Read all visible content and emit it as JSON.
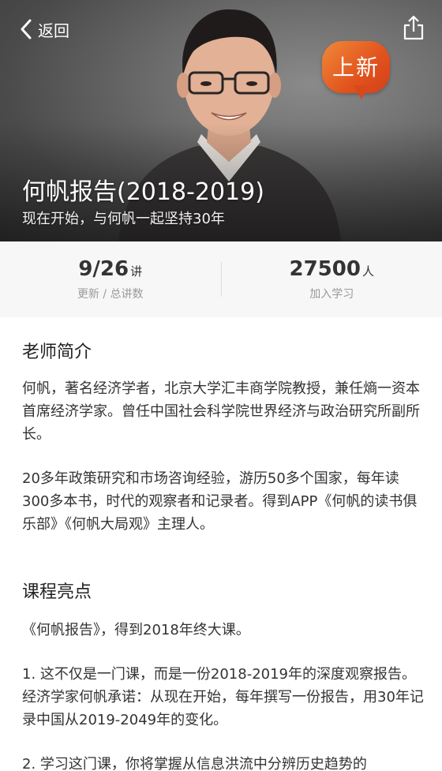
{
  "header": {
    "back_label": "返回",
    "badge_text": "上新",
    "title": "何帆报告(2018-2019)",
    "subtitle": "现在开始，与何帆一起坚持30年"
  },
  "stats": {
    "updates": {
      "value": "9/26",
      "unit": "讲",
      "label": "更新 / 总讲数"
    },
    "learners": {
      "value": "27500",
      "unit": "人",
      "label": "加入学习"
    }
  },
  "teacher": {
    "title": "老师简介",
    "para1": "何帆，著名经济学者，北京大学汇丰商学院教授，兼任熵一资本首席经济学家。曾任中国社会科学院世界经济与政治研究所副所长。",
    "para2": "20多年政策研究和市场咨询经验，游历50多个国家，每年读300多本书，时代的观察者和记录者。得到APP《何帆的读书俱乐部》《何帆大局观》主理人。"
  },
  "highlights": {
    "title": "课程亮点",
    "para1": "《何帆报告》，得到2018年终大课。",
    "para2": "1. 这不仅是一门课，而是一份2018-2019年的深度观察报告。经济学家何帆承诺：从现在开始，每年撰写一份报告，用30年记录中国从2019-2049年的变化。",
    "para3": "2. 学习这门课，你将掌握从信息洪流中分辨历史趋势的"
  }
}
